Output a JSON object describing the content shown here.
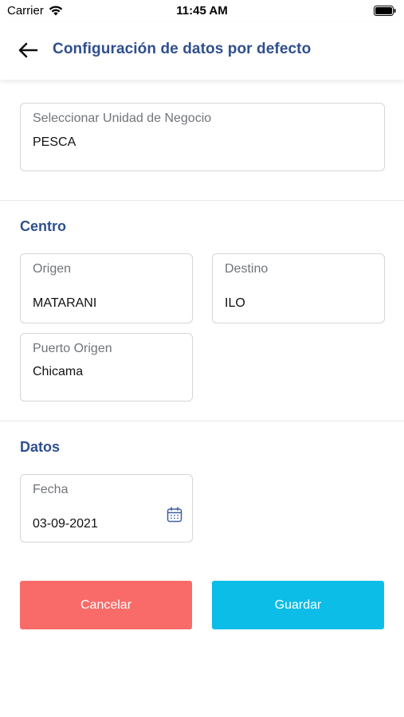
{
  "status_bar": {
    "carrier": "Carrier",
    "time": "11:45 AM"
  },
  "header": {
    "title": "Configuración de datos por defecto",
    "back_icon": "arrow-left-icon"
  },
  "business_unit": {
    "label": "Seleccionar Unidad de Negocio",
    "value": "PESCA"
  },
  "centro": {
    "section_title": "Centro",
    "origen": {
      "label": "Origen",
      "value": "MATARANI"
    },
    "destino": {
      "label": "Destino",
      "value": "ILO"
    },
    "puerto_origen": {
      "label": "Puerto Origen",
      "value": "Chicama"
    }
  },
  "datos": {
    "section_title": "Datos",
    "fecha": {
      "label": "Fecha",
      "value": "03-09-2021",
      "icon": "calendar-icon"
    }
  },
  "actions": {
    "cancel_label": "Cancelar",
    "save_label": "Guardar"
  },
  "colors": {
    "primary_title": "#2f4f8f",
    "cancel": "#f86b69",
    "save": "#0cbde8",
    "border": "#d3d6da"
  }
}
